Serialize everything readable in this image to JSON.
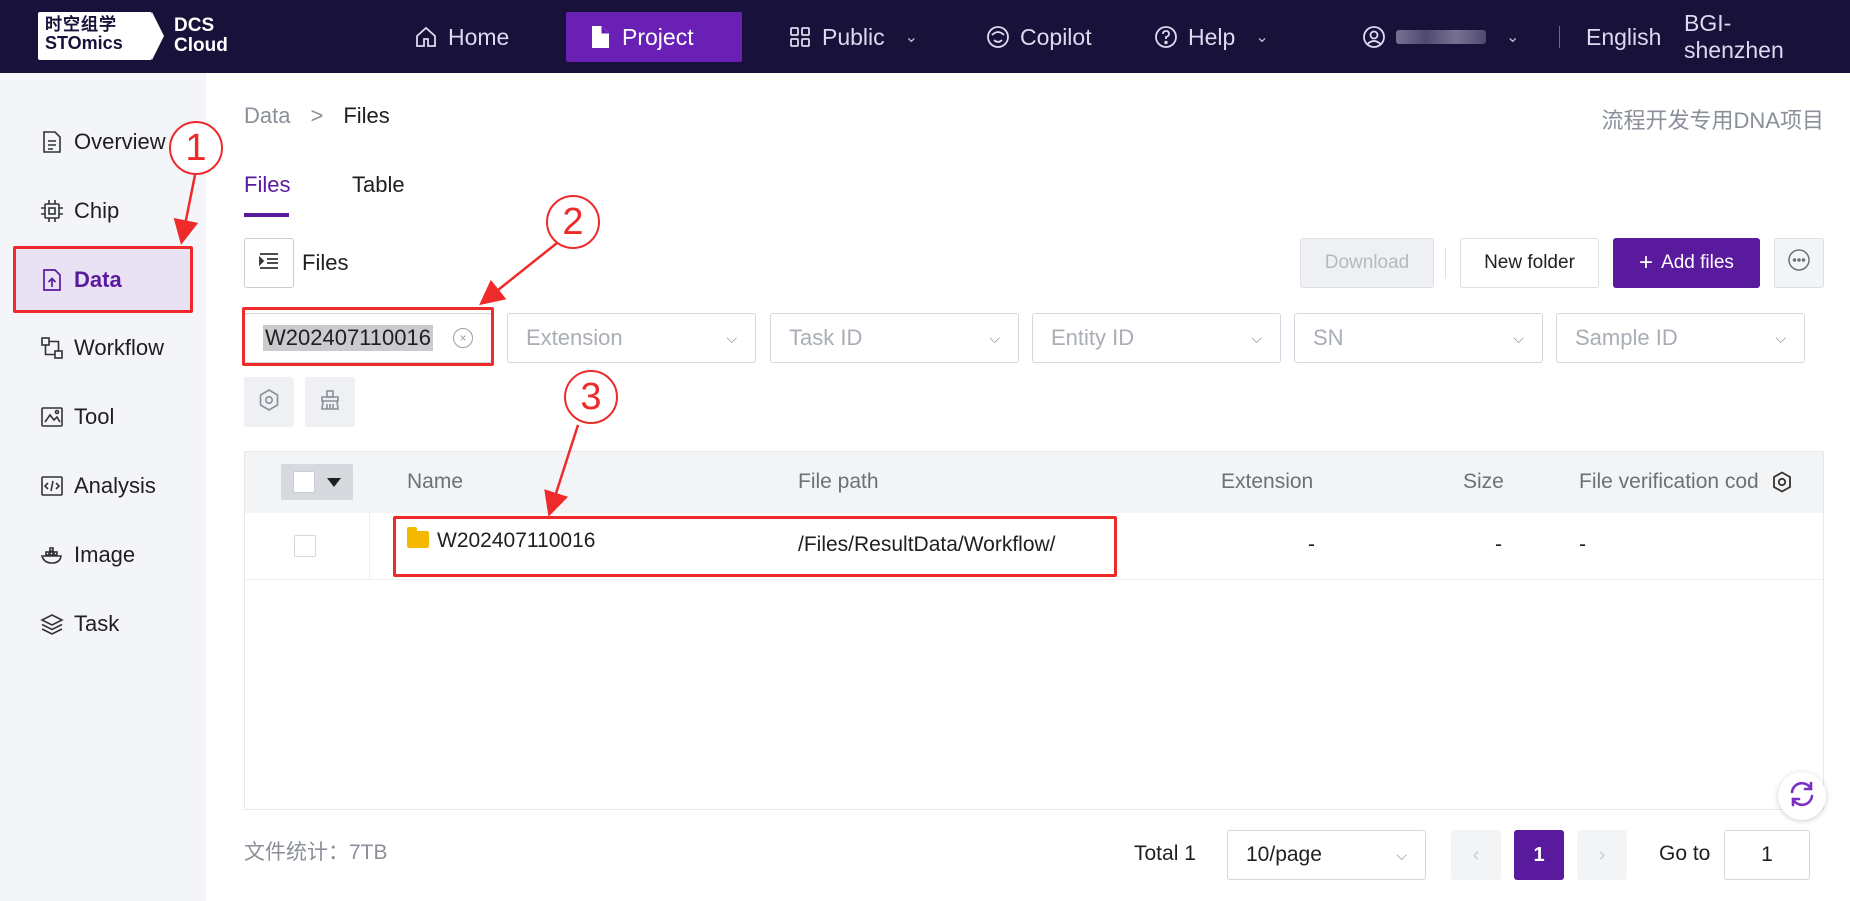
{
  "app": {
    "logo_line1": "时空组学",
    "logo_line2": "STOmics",
    "logo_dcs": "DCS",
    "logo_cloud": "Cloud"
  },
  "topnav": {
    "items": [
      {
        "label": "Home",
        "icon": "home-icon"
      },
      {
        "label": "Project",
        "icon": "document-icon",
        "active": true
      },
      {
        "label": "Public",
        "icon": "grid-icon",
        "dropdown": true
      },
      {
        "label": "Copilot",
        "icon": "copilot-icon"
      },
      {
        "label": "Help",
        "icon": "help-icon",
        "dropdown": true
      }
    ],
    "language": "English",
    "region": "BGI-shenzhen"
  },
  "sidebar": {
    "items": [
      {
        "label": "Overview",
        "icon": "overview-icon"
      },
      {
        "label": "Chip",
        "icon": "chip-icon"
      },
      {
        "label": "Data",
        "icon": "data-icon",
        "active": true
      },
      {
        "label": "Workflow",
        "icon": "workflow-icon"
      },
      {
        "label": "Tool",
        "icon": "tool-icon"
      },
      {
        "label": "Analysis",
        "icon": "analysis-icon"
      },
      {
        "label": "Image",
        "icon": "image-icon"
      },
      {
        "label": "Task",
        "icon": "task-icon"
      }
    ]
  },
  "breadcrumb": {
    "root": "Data",
    "separator": ">",
    "current": "Files"
  },
  "project_name": "流程开发专用DNA项目",
  "tabs": [
    {
      "label": "Files",
      "active": true
    },
    {
      "label": "Table"
    }
  ],
  "files_header": {
    "label": "Files"
  },
  "toolbar": {
    "download": "Download",
    "new_folder": "New folder",
    "add_files": "Add files"
  },
  "filters": {
    "search_value": "W202407110016",
    "extension": "Extension",
    "task_id": "Task ID",
    "entity_id": "Entity ID",
    "sn": "SN",
    "sample_id": "Sample ID"
  },
  "table": {
    "columns": [
      "Name",
      "File path",
      "Extension",
      "Size",
      "File verification cod"
    ],
    "rows": [
      {
        "name": "W202407110016",
        "path": "/Files/ResultData/Workflow/",
        "extension": "-",
        "size": "-",
        "verification": "-"
      }
    ]
  },
  "footer": {
    "stats": "文件统计：7TB",
    "total": "Total 1",
    "page_size": "10/page",
    "current_page": "1",
    "goto_label": "Go to",
    "goto_value": "1"
  },
  "annotations": [
    "1",
    "2",
    "3"
  ],
  "colors": {
    "brand": "#5a1a9e",
    "topbar": "#18123a",
    "annotation": "#ee2a2a"
  }
}
